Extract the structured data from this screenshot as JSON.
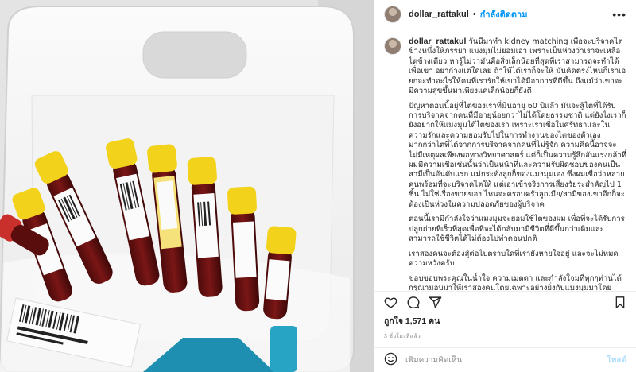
{
  "post": {
    "username": "dollar_rattakul",
    "separator": "•",
    "follow_status": "กำลังติดตาม",
    "more_icon": "more-horizontal-icon",
    "caption": {
      "paragraphs": [
        "วันนี้มาทำ kidney matching เพื่อจะบริจาคไตข้างหนึ่งให้ภรรยา แมงมุมไม่ยอมเอา เพราะเป็นห่วงว่าเราจะเหลือไตข้างเดียว หารู้ไม่ว่ามันคือสิ่งเล็กน้อยที่สุดที่เราสามารถจะทำได้เพื่อเขา อยากำงแต่ใดเลย ถ้าให้ได้เราก็จะให้ มันคิดตรงไหนก็เราเอยกจะทำอะไรให้คนที่เรารักให้เขาได้มีอาการที่ดีขึ้น ถึงแม้ว่าเขาจะมีความสุขขึ้นมาเพียงแค่เล็กน้อยก็ยังดี",
        "ปัญหาตอนนี้อยู่ที่ไตของเราที่มีนอายุ 60 ปีแล้ว มันจะสู้ไตที่ได้รับการบริจาคจากคนที่มีอายุน้อยกว่าไม่ได้โดยธรรมชาติ แต่ยังไงเราก็ยังอยากให้แมงมุมได้ไตของเรา เพราะเราเชื่อในศรัทธาและในความรักและความยอมรับไปในการทำงานของไตของตัวเองมากกว่าไตที่ได้จากการบริจาคจากคนที่ไม่รู้จัก ความคิดนี้อาจจะไม่มีเหตุผลเพียงพอทางวิทยาศาสตร์ แต่ก็เป็นความรู้สึกอันแรงกล้าที่ผมมีความเชื่อเช่นนั้นว่าเป็นหน้าที่และความรับผิดชอบของคนเป็นสามีเป็นอันดับแรก แม่กระทั่งลูกก็ของแมงมุมเอง ซึ่งผมเชื่อว่าหลายคนพร้อมที่จะบริจาคไตให้ แต่เอาเข้าจริงการเสี่ยงวัยระสำคัญไป 1 ชิ้น ไม่ใช่เรื่องขายของ ไหนจะครอบครัวลูกเมีย/สามีของเขาอีกก็จะต้องเป็นห่วงในความปลอดภัยของผู้บริจาค",
        "ตอนนี้เรามีกำลังใจว่าแมงมุมจะยอมใช้ไตของผม เพื่อที่จะได้รับการปลูกถ่ายที่เร็วที่สุดเพื่อที่จะได้กลับมามีชีวิตที่ดีขึ้นกว่าเดิมและสามารถใช้ชีวิตได้ไม่ต้องไปทำดอนปกติ",
        "เราสองคนจะต้องสู้ต่อไปตราบใดที่เรายังหายใจอยู่ และจะไม่หมดความหวังครับ",
        "ขอบขอบพระคุณในน้ำใจ ความเมตตา และกำลังใจมที่ทุกๆท่านได้กรุณามอบมาให้เราสองคนโดยเฉพาะอย่างยิ่งกับแมงมุมมาโดยตลอดครับ มันมีความหมายมากๆสำหรับเราสองครับ"
      ]
    },
    "actions": {
      "like_icon": "heart-icon",
      "comment_icon": "comment-icon",
      "share_icon": "share-icon",
      "save_icon": "bookmark-icon"
    },
    "likes_text": "ถูกใจ 1,571 คน",
    "time_text": "3 ชั่วโมงที่แล้ว",
    "comment_box": {
      "emoji_icon": "emoji-icon",
      "placeholder": "เพิ่มความคิดเห็น",
      "post_label": "โพสต์"
    }
  },
  "photo": {
    "description_colors": {
      "cap_yellow": "#f2d21b",
      "blood": "#6b1212",
      "basket": "#f7f7f7",
      "teal": "#1e8fb0"
    }
  },
  "colors": {
    "link_blue": "#0095f6",
    "muted": "#8e8e8e",
    "post_disabled": "#b2dffc"
  }
}
